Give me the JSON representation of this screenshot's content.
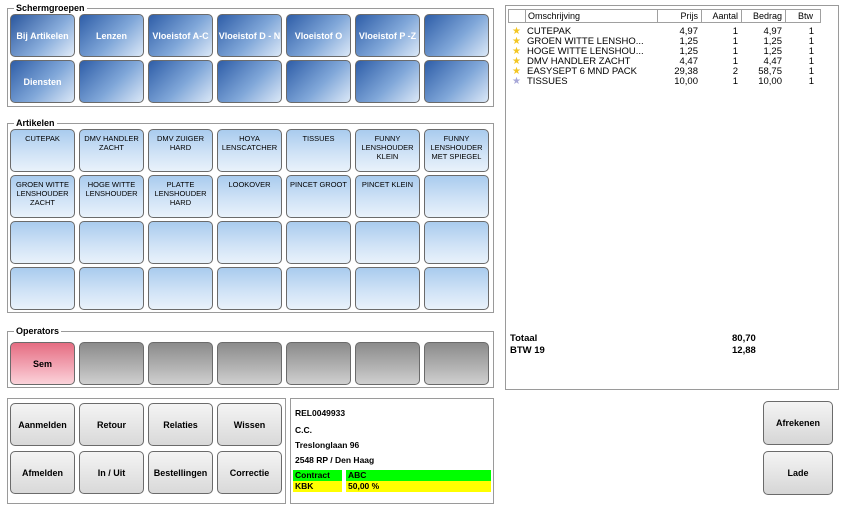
{
  "schermgroepen": {
    "label": "Schermgroepen",
    "buttons": [
      "Bij Artikelen",
      "Lenzen",
      "Vloeistof A-C",
      "Vloeistof D - N",
      "Vloeistof O",
      "Vloeistof P -Z",
      "",
      "Diensten",
      "",
      "",
      "",
      "",
      "",
      ""
    ]
  },
  "artikelen": {
    "label": "Artikelen",
    "buttons": [
      "CUTEPAK",
      "DMV HANDLER ZACHT",
      "DMV ZUIGER HARD",
      "HOYA LENSCATCHER",
      "TISSUES",
      "FUNNY LENSHOUDER KLEIN",
      "FUNNY LENSHOUDER MET SPIEGEL",
      "GROEN WITTE LENSHOUDER ZACHT",
      "HOGE WITTE LENSHOUDER",
      "PLATTE LENSHOUDER HARD",
      "LOOKOVER",
      "PINCET GROOT",
      "PINCET KLEIN",
      "",
      "",
      "",
      "",
      "",
      "",
      "",
      "",
      "",
      "",
      "",
      "",
      "",
      "",
      ""
    ]
  },
  "operators": {
    "label": "Operators",
    "buttons": [
      "Sem",
      "",
      "",
      "",
      "",
      "",
      ""
    ]
  },
  "controls": {
    "buttons": [
      "Aanmelden",
      "Retour",
      "Relaties",
      "Wissen",
      "Afmelden",
      "In / Uit",
      "Bestellingen",
      "Correctie"
    ]
  },
  "customer": {
    "id": "REL0049933",
    "name": "C.C.",
    "street": "Treslonglaan 96",
    "city": "2548 RP / Den Haag",
    "contract_label": "Contract",
    "contract_value": "ABC",
    "kbk_label": "KBK",
    "kbk_value": "50,00 %",
    "colors": {
      "contract": "#00ff00",
      "kbk": "#ffff00"
    }
  },
  "receipt": {
    "headers": {
      "description": "Omschrijving",
      "price": "Prijs",
      "qty": "Aantal",
      "amount": "Bedrag",
      "vat": "Btw"
    },
    "rows": [
      {
        "icon": "star-icon",
        "star_color": "#f3c623",
        "description": "CUTEPAK",
        "price": "4,97",
        "qty": "1",
        "amount": "4,97",
        "vat": "1"
      },
      {
        "icon": "star-icon",
        "star_color": "#f3c623",
        "description": "GROEN WITTE LENSHO...",
        "price": "1,25",
        "qty": "1",
        "amount": "1,25",
        "vat": "1"
      },
      {
        "icon": "star-icon",
        "star_color": "#f3c623",
        "description": "HOGE WITTE LENSHOU...",
        "price": "1,25",
        "qty": "1",
        "amount": "1,25",
        "vat": "1"
      },
      {
        "icon": "star-icon",
        "star_color": "#f3c623",
        "description": "DMV HANDLER ZACHT",
        "price": "4,47",
        "qty": "1",
        "amount": "4,47",
        "vat": "1"
      },
      {
        "icon": "star-icon",
        "star_color": "#f3c623",
        "description": "EASYSEPT 6 MND PACK",
        "price": "29,38",
        "qty": "2",
        "amount": "58,75",
        "vat": "1"
      },
      {
        "icon": "star-icon",
        "star_color": "#a8a8d8",
        "description": "TISSUES",
        "price": "10,00",
        "qty": "1",
        "amount": "10,00",
        "vat": "1"
      }
    ],
    "total_label": "Totaal",
    "total_value": "80,70",
    "vat_label": "BTW 19",
    "vat_value": "12,88"
  },
  "actions": {
    "checkout": "Afrekenen",
    "drawer": "Lade"
  }
}
